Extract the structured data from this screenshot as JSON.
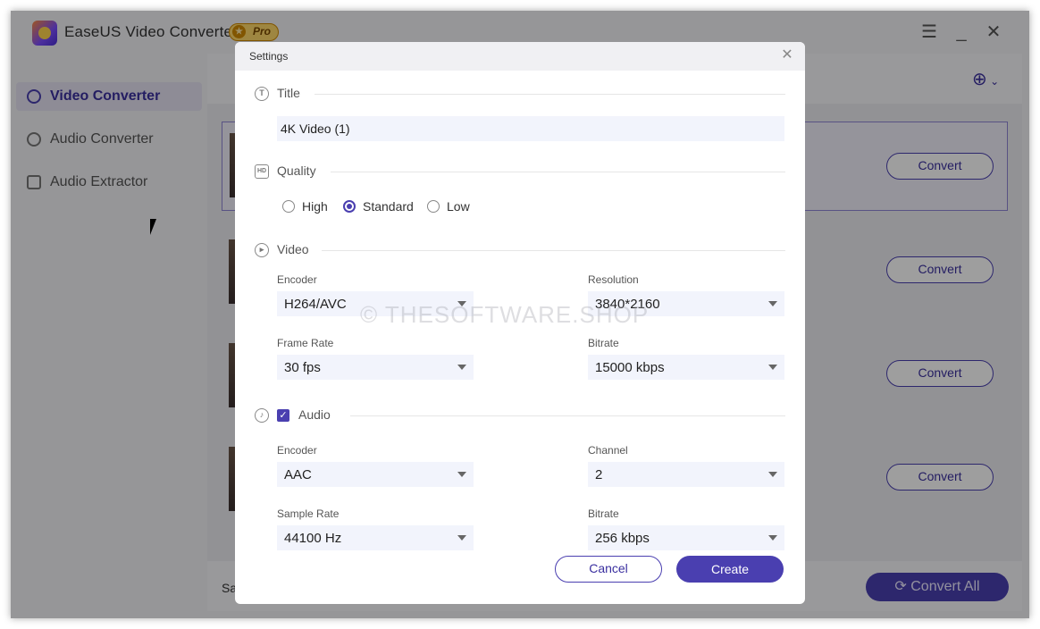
{
  "app": {
    "title": "EaseUS Video Converter",
    "badge": "Pro",
    "window_controls": [
      "menu-icon",
      "minimize-icon",
      "close-icon"
    ]
  },
  "sidebar": {
    "items": [
      {
        "label": "Video Converter",
        "icon": "video-convert-icon",
        "active": true
      },
      {
        "label": "Audio Converter",
        "icon": "audio-convert-icon",
        "active": false
      },
      {
        "label": "Audio Extractor",
        "icon": "audio-extract-icon",
        "active": false
      }
    ]
  },
  "main": {
    "convert_buttons": [
      "Convert",
      "Convert",
      "Convert",
      "Convert"
    ],
    "bottom": {
      "save_label": "Sa",
      "convert_all": "Convert All"
    }
  },
  "dialog": {
    "title": "Settings",
    "sections": {
      "title": {
        "label": "Title",
        "icon": "title-icon"
      },
      "quality": {
        "label": "Quality",
        "icon": "hd-icon"
      },
      "video": {
        "label": "Video",
        "icon": "play-circle-icon"
      },
      "audio": {
        "label": "Audio",
        "icon": "music-note-icon",
        "checked": true
      }
    },
    "title_value": "4K Video (1)",
    "quality_options": [
      {
        "label": "High",
        "selected": false
      },
      {
        "label": "Standard",
        "selected": true
      },
      {
        "label": "Low",
        "selected": false
      }
    ],
    "video": {
      "encoder_label": "Encoder",
      "encoder_value": "H264/AVC",
      "resolution_label": "Resolution",
      "resolution_value": "3840*2160",
      "framerate_label": "Frame Rate",
      "framerate_value": "30 fps",
      "bitrate_label": "Bitrate",
      "bitrate_value": "15000 kbps"
    },
    "audio": {
      "encoder_label": "Encoder",
      "encoder_value": "AAC",
      "channel_label": "Channel",
      "channel_value": "2",
      "samplerate_label": "Sample Rate",
      "samplerate_value": "44100 Hz",
      "bitrate_label": "Bitrate",
      "bitrate_value": "256 kbps"
    },
    "cancel_label": "Cancel",
    "create_label": "Create"
  },
  "watermark": "© THESOFTWARE.SHOP",
  "colors": {
    "accent": "#4a3fb0",
    "pro_badge": "#ffd86a"
  }
}
